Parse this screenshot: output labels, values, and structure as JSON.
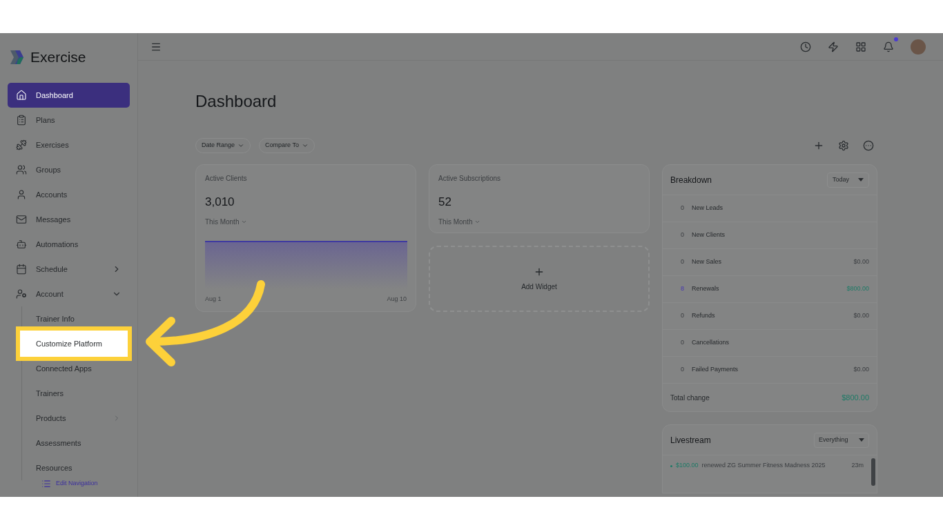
{
  "brand": {
    "name": "Exercise"
  },
  "sidebar": {
    "items": [
      {
        "label": "Dashboard",
        "selected": true
      },
      {
        "label": "Plans",
        "selected": false
      },
      {
        "label": "Exercises",
        "selected": false
      },
      {
        "label": "Groups",
        "selected": false
      },
      {
        "label": "Accounts",
        "selected": false
      },
      {
        "label": "Messages",
        "selected": false
      },
      {
        "label": "Automations",
        "selected": false
      },
      {
        "label": "Schedule",
        "selected": false,
        "expanded": false
      },
      {
        "label": "Account",
        "selected": false,
        "expanded": true,
        "children": [
          {
            "label": "Trainer Info",
            "highlighted": false
          },
          {
            "label": "Customize Platform",
            "highlighted": true
          },
          {
            "label": "Connected Apps",
            "highlighted": false
          },
          {
            "label": "Trainers",
            "highlighted": false
          },
          {
            "label": "Products",
            "highlighted": false,
            "expanded": false
          },
          {
            "label": "Assessments",
            "highlighted": false
          },
          {
            "label": "Resources",
            "highlighted": false
          }
        ]
      }
    ],
    "edit_link": "Edit Navigation"
  },
  "top_bar": {
    "notifications": {
      "unread": true
    }
  },
  "page": {
    "title": "Dashboard",
    "filters": [
      "Date Range",
      "Compare To"
    ]
  },
  "cards": [
    {
      "title": "Active Clients",
      "value": "3,010",
      "period": "This Month",
      "x_labels": [
        "Aug 1",
        "Aug 10"
      ]
    },
    {
      "title": "Active Subscriptions",
      "value": "52",
      "period": "This Month"
    }
  ],
  "add_widget": {
    "label": "Add Widget"
  },
  "breakdown": {
    "title": "Breakdown",
    "period": "Today",
    "rows": [
      {
        "count": "0",
        "label": "New Leads",
        "positive": false
      },
      {
        "count": "0",
        "label": "New Clients",
        "positive": false
      },
      {
        "count": "0",
        "label": "New Sales",
        "amount": "$0.00",
        "positive": false
      },
      {
        "count": "8",
        "label": "Renewals",
        "amount": "$800.00",
        "positive": true
      },
      {
        "count": "0",
        "label": "Refunds",
        "amount": "$0.00",
        "positive": false
      },
      {
        "count": "0",
        "label": "Cancellations",
        "positive": false
      },
      {
        "count": "0",
        "label": "Failed Payments",
        "amount": "$0.00",
        "positive": false
      }
    ],
    "total_label": "Total change",
    "total": "$800.00"
  },
  "livestream": {
    "title": "Livestream",
    "filter": "Everything",
    "entries": [
      {
        "amount": "$100.00",
        "text": "renewed ZG Summer Fitness Madness 2025",
        "time": "23m"
      }
    ]
  }
}
